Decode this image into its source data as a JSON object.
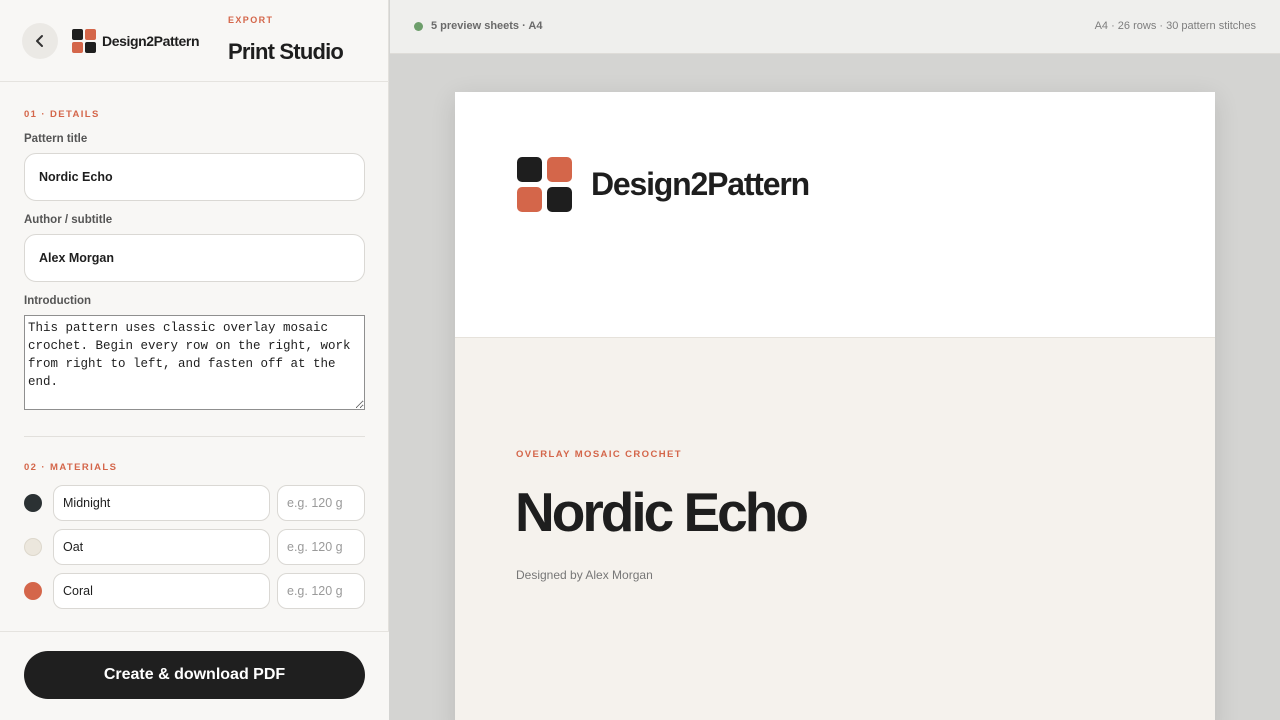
{
  "header": {
    "brand": "Design2Pattern",
    "eyebrow": "EXPORT",
    "title": "Print Studio"
  },
  "details": {
    "section_label": "01 · DETAILS",
    "title_label": "Pattern title",
    "title_value": "Nordic Echo",
    "author_label": "Author / subtitle",
    "author_value": "Alex Morgan",
    "intro_label": "Introduction",
    "intro_value": "This pattern uses classic overlay mosaic crochet. Begin every row on the right, work from right to left, and fasten off at the end."
  },
  "materials": {
    "section_label": "02 · MATERIALS",
    "items": [
      {
        "name": "Midnight",
        "color": "#2b3133",
        "weight_placeholder": "e.g. 120 g"
      },
      {
        "name": "Oat",
        "color": "#ece7dd",
        "weight_placeholder": "e.g. 120 g"
      },
      {
        "name": "Coral",
        "color": "#d4664a",
        "weight_placeholder": "e.g. 120 g"
      }
    ]
  },
  "footer": {
    "cta_label": "Create & download PDF"
  },
  "preview": {
    "status": "5 preview sheets · A4",
    "meta": "A4 · 26 rows · 30 pattern stitches",
    "brand": "Design2Pattern",
    "eyebrow": "OVERLAY MOSAIC CROCHET",
    "title": "Nordic Echo",
    "byline": "Designed by Alex Morgan"
  },
  "colors": {
    "accent": "#d4664a",
    "dark": "#1e1e1e",
    "status_ok": "#6d9e6b"
  }
}
